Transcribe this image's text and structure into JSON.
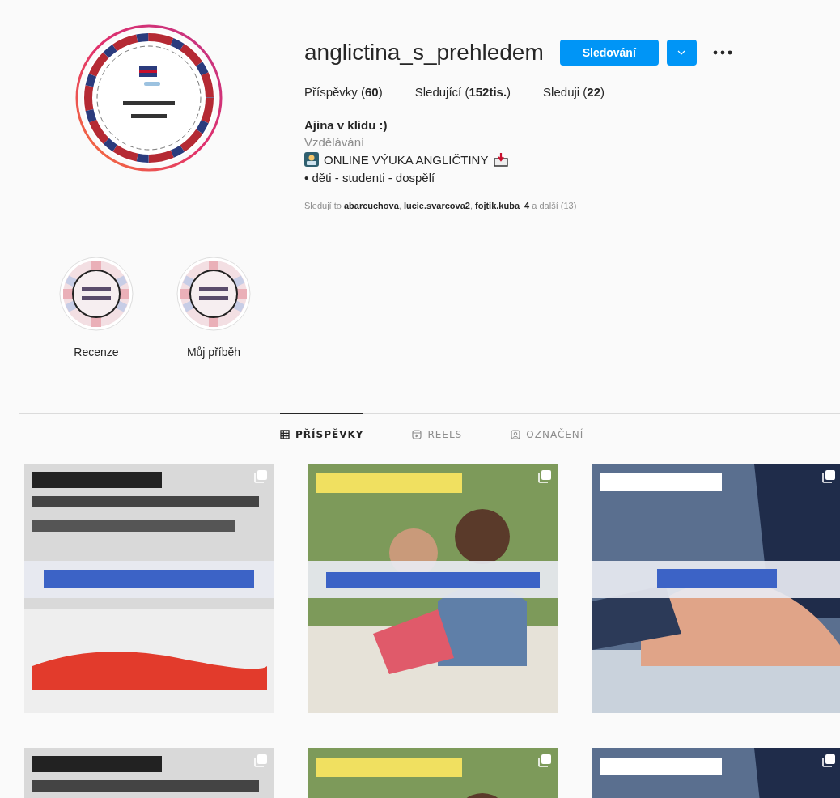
{
  "profile": {
    "username": "anglictina_s_prehledem",
    "follow_button": "Sledování",
    "stats": [
      "Příspěvky (**60**)",
      "Sledující (**152tis.**)",
      "Sleduji (**22**)"
    ],
    "name": "Ajina v klidu :)",
    "category": "Vzdělávání",
    "bio": [
      "ONLINE VÝUKA ANGLIČTINY",
      "• děti - studenti - dospělí"
    ],
    "followed_by": "Sledují to **abarcuchova**, **lucie.svarcova2**, **fojtik.kuba_4** a další (13)"
  },
  "highlights": [
    {
      "label": "Recenze"
    },
    {
      "label": "Můj příběh"
    }
  ],
  "tabs": [
    {
      "label": "PŘÍSPĚVKY",
      "kind": "grid",
      "selected": true
    },
    {
      "label": "REELS",
      "kind": "reels",
      "selected": false
    },
    {
      "label": "OZNAČENÍ",
      "kind": "tagged",
      "selected": false
    }
  ],
  "posts": [
    {
      "kind": "picture",
      "carousel": true
    },
    {
      "kind": "picture",
      "carousel": true
    },
    {
      "kind": "picture",
      "carousel": true
    },
    {
      "kind": "picture",
      "carousel": true
    },
    {
      "kind": "picture",
      "carousel": true
    },
    {
      "kind": "picture",
      "carousel": true
    }
  ]
}
